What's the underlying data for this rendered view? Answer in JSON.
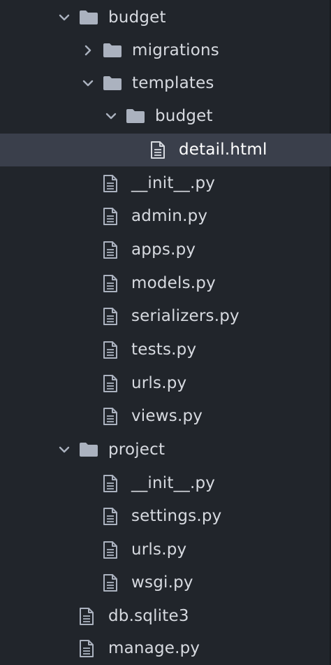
{
  "file_tree": {
    "budget_folder": {
      "label": "budget",
      "expanded": true
    },
    "migrations_folder": {
      "label": "migrations",
      "expanded": false
    },
    "templates_folder": {
      "label": "templates",
      "expanded": true
    },
    "templates_budget_folder": {
      "label": "budget",
      "expanded": true
    },
    "detail_html": {
      "label": "detail.html",
      "selected": true
    },
    "budget_files": [
      "__init__.py",
      "admin.py",
      "apps.py",
      "models.py",
      "serializers.py",
      "tests.py",
      "urls.py",
      "views.py"
    ],
    "project_folder": {
      "label": "project",
      "expanded": true
    },
    "project_files": [
      "__init__.py",
      "settings.py",
      "urls.py",
      "wsgi.py"
    ],
    "root_files": [
      "db.sqlite3",
      "manage.py"
    ]
  },
  "colors": {
    "background": "#21252b",
    "selection": "#3a3f4b",
    "text": "#d7dae0",
    "icon": "#abb2bf"
  }
}
